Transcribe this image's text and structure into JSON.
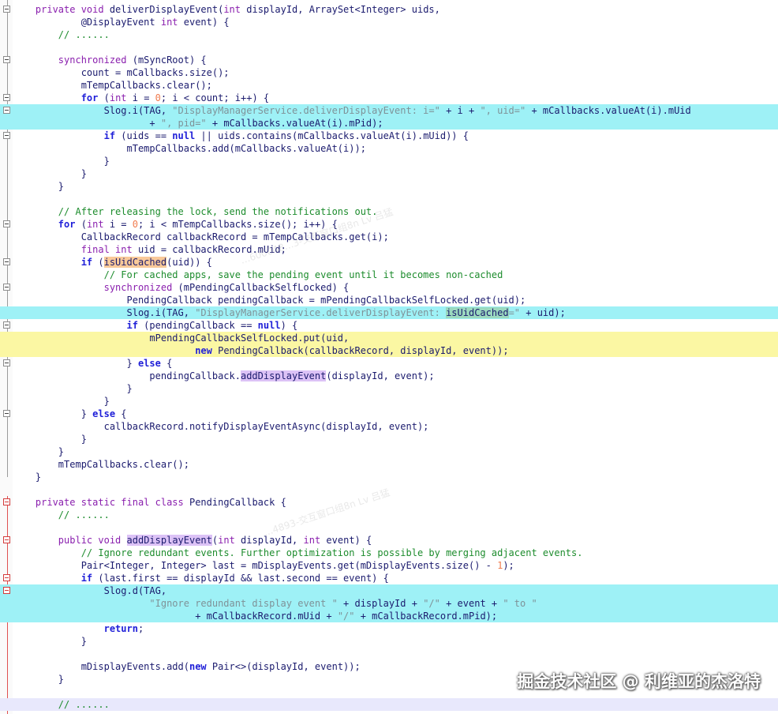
{
  "watermark": "掘金技术社区 @ 利维亚的杰洛特",
  "faint_watermarks": [
    "…600048…3-交互窗口组8n Lv 吕猛",
    "…4893-交互窗口组8n Lv 吕猛"
  ],
  "colors": {
    "highlight_cyan": "#9ef1f6",
    "highlight_yellow": "#fbf7a3",
    "highlight_lavender": "#e8e8fc",
    "keyword": "#8a1fae",
    "literal_keyword": "#1f1fd8",
    "string": "#7f9298",
    "number": "#f07c4f",
    "comment": "#1d8c2d",
    "identifier": "#1b1b6e"
  },
  "code_lines": [
    {
      "fold": "minus",
      "hl": "",
      "tokens": [
        [
          "    ",
          ""
        ],
        [
          "private void",
          "kw"
        ],
        [
          " deliverDisplayEvent(",
          ""
        ],
        [
          "int",
          "kw"
        ],
        [
          " displayId, ArraySet<Integer> uids,",
          ""
        ]
      ]
    },
    {
      "fold": "",
      "hl": "",
      "tokens": [
        [
          "            @DisplayEvent ",
          ""
        ],
        [
          "int",
          "kw"
        ],
        [
          " event) {",
          ""
        ]
      ]
    },
    {
      "fold": "",
      "hl": "",
      "tokens": [
        [
          "        ",
          ""
        ],
        [
          "// ......",
          "cmt"
        ]
      ]
    },
    {
      "fold": "",
      "hl": "",
      "tokens": [
        [
          "",
          ""
        ]
      ]
    },
    {
      "fold": "minus",
      "hl": "",
      "tokens": [
        [
          "        ",
          ""
        ],
        [
          "synchronized",
          "kw"
        ],
        [
          " (mSyncRoot) {",
          ""
        ]
      ]
    },
    {
      "fold": "",
      "hl": "",
      "tokens": [
        [
          "            count = mCallbacks.size();",
          ""
        ]
      ]
    },
    {
      "fold": "",
      "hl": "",
      "tokens": [
        [
          "            mTempCallbacks.clear();",
          ""
        ]
      ]
    },
    {
      "fold": "minus",
      "hl": "",
      "tokens": [
        [
          "            ",
          ""
        ],
        [
          "for",
          "kw2"
        ],
        [
          " (",
          ""
        ],
        [
          "int",
          "kw"
        ],
        [
          " i = ",
          ""
        ],
        [
          "0",
          "num"
        ],
        [
          "; i < count; i++) {",
          ""
        ]
      ]
    },
    {
      "fold": "minus",
      "hl": "cyan",
      "tokens": [
        [
          "                Slog.i(TAG, ",
          ""
        ],
        [
          "\"DisplayManagerService.deliverDisplayEvent: i=\"",
          "str"
        ],
        [
          " + i + ",
          ""
        ],
        [
          "\", uid=\"",
          "str"
        ],
        [
          " + mCallbacks.valueAt(i).mUid",
          ""
        ]
      ]
    },
    {
      "fold": "",
      "hl": "cyan",
      "tokens": [
        [
          "                        + ",
          ""
        ],
        [
          "\", pid=\"",
          "str"
        ],
        [
          " + mCallbacks.valueAt(i).mPid);",
          ""
        ]
      ]
    },
    {
      "fold": "minus",
      "hl": "",
      "tokens": [
        [
          "                ",
          ""
        ],
        [
          "if",
          "kw2"
        ],
        [
          " (uids == ",
          ""
        ],
        [
          "null",
          "kw2"
        ],
        [
          " || uids.contains(mCallbacks.valueAt(i).mUid)) {",
          ""
        ]
      ]
    },
    {
      "fold": "",
      "hl": "",
      "tokens": [
        [
          "                    mTempCallbacks.add(mCallbacks.valueAt(i));",
          ""
        ]
      ]
    },
    {
      "fold": "",
      "hl": "",
      "tokens": [
        [
          "                }",
          ""
        ]
      ]
    },
    {
      "fold": "",
      "hl": "",
      "tokens": [
        [
          "            }",
          ""
        ]
      ]
    },
    {
      "fold": "",
      "hl": "",
      "tokens": [
        [
          "        }",
          ""
        ]
      ]
    },
    {
      "fold": "",
      "hl": "",
      "tokens": [
        [
          "",
          ""
        ]
      ]
    },
    {
      "fold": "",
      "hl": "",
      "tokens": [
        [
          "        ",
          ""
        ],
        [
          "// After releasing the lock, send the notifications out.",
          "cmt"
        ]
      ]
    },
    {
      "fold": "minus",
      "hl": "",
      "tokens": [
        [
          "        ",
          ""
        ],
        [
          "for",
          "kw2"
        ],
        [
          " (",
          ""
        ],
        [
          "int",
          "kw"
        ],
        [
          " i = ",
          ""
        ],
        [
          "0",
          "num"
        ],
        [
          "; i < mTempCallbacks.size(); i++) {",
          ""
        ]
      ]
    },
    {
      "fold": "",
      "hl": "",
      "tokens": [
        [
          "            CallbackRecord callbackRecord = mTempCallbacks.get(i);",
          ""
        ]
      ]
    },
    {
      "fold": "",
      "hl": "",
      "tokens": [
        [
          "            ",
          ""
        ],
        [
          "final int",
          "kw"
        ],
        [
          " uid = callbackRecord.mUid;",
          ""
        ]
      ]
    },
    {
      "fold": "minus",
      "hl": "",
      "tokens": [
        [
          "            ",
          ""
        ],
        [
          "if",
          "kw2"
        ],
        [
          " (",
          ""
        ],
        [
          "isUidCached",
          "occ-orange"
        ],
        [
          "(uid)) {",
          ""
        ]
      ]
    },
    {
      "fold": "",
      "hl": "",
      "tokens": [
        [
          "                ",
          ""
        ],
        [
          "// For cached apps, save the pending event until it becomes non-cached",
          "cmt"
        ]
      ]
    },
    {
      "fold": "minus",
      "hl": "",
      "tokens": [
        [
          "                ",
          ""
        ],
        [
          "synchronized",
          "kw"
        ],
        [
          " (mPendingCallbackSelfLocked) {",
          ""
        ]
      ]
    },
    {
      "fold": "",
      "hl": "",
      "tokens": [
        [
          "                    PendingCallback pendingCallback = mPendingCallbackSelfLocked.get(uid);",
          ""
        ]
      ]
    },
    {
      "fold": "",
      "hl": "cyan",
      "tokens": [
        [
          "                    Slog.i(TAG, ",
          ""
        ],
        [
          "\"DisplayManagerService.deliverDisplayEvent: ",
          "str"
        ],
        [
          "isUidCached",
          "occ-green"
        ],
        [
          "=\"",
          "str"
        ],
        [
          " + uid);",
          ""
        ]
      ]
    },
    {
      "fold": "minus",
      "hl": "",
      "tokens": [
        [
          "                    ",
          ""
        ],
        [
          "if",
          "kw2"
        ],
        [
          " (pendingCallback == ",
          ""
        ],
        [
          "null",
          "kw2"
        ],
        [
          ") {",
          ""
        ]
      ]
    },
    {
      "fold": "",
      "hl": "yellow",
      "tokens": [
        [
          "                        mPendingCallbackSelfLocked.put(uid,",
          ""
        ]
      ]
    },
    {
      "fold": "",
      "hl": "yellow",
      "tokens": [
        [
          "                                ",
          ""
        ],
        [
          "new",
          "kw2"
        ],
        [
          " PendingCallback(callbackRecord, displayId, event));",
          ""
        ]
      ]
    },
    {
      "fold": "minus",
      "hl": "",
      "tokens": [
        [
          "                    } ",
          ""
        ],
        [
          "else",
          "kw2"
        ],
        [
          " {",
          ""
        ]
      ]
    },
    {
      "fold": "",
      "hl": "",
      "tokens": [
        [
          "                        pendingCallback.",
          ""
        ],
        [
          "addDisplayEvent",
          "occ-purple"
        ],
        [
          "(displayId, event);",
          ""
        ]
      ]
    },
    {
      "fold": "",
      "hl": "",
      "tokens": [
        [
          "                    }",
          ""
        ]
      ]
    },
    {
      "fold": "",
      "hl": "",
      "tokens": [
        [
          "                }",
          ""
        ]
      ]
    },
    {
      "fold": "minus",
      "hl": "",
      "tokens": [
        [
          "            } ",
          ""
        ],
        [
          "else",
          "kw2"
        ],
        [
          " {",
          ""
        ]
      ]
    },
    {
      "fold": "",
      "hl": "",
      "tokens": [
        [
          "                callbackRecord.notifyDisplayEventAsync(displayId, event);",
          ""
        ]
      ]
    },
    {
      "fold": "",
      "hl": "",
      "tokens": [
        [
          "            }",
          ""
        ]
      ]
    },
    {
      "fold": "",
      "hl": "",
      "tokens": [
        [
          "        }",
          ""
        ]
      ]
    },
    {
      "fold": "",
      "hl": "",
      "tokens": [
        [
          "        mTempCallbacks.clear();",
          ""
        ]
      ]
    },
    {
      "fold": "",
      "hl": "",
      "tokens": [
        [
          "    }",
          ""
        ]
      ]
    },
    {
      "fold": "",
      "hl": "",
      "tokens": [
        [
          "",
          ""
        ]
      ]
    },
    {
      "fold": "minus-red",
      "hl": "",
      "tokens": [
        [
          "    ",
          ""
        ],
        [
          "private static final class",
          "kw"
        ],
        [
          " PendingCallback {",
          ""
        ]
      ]
    },
    {
      "fold": "",
      "hl": "",
      "tokens": [
        [
          "        ",
          ""
        ],
        [
          "// ......",
          "cmt"
        ]
      ]
    },
    {
      "fold": "",
      "hl": "",
      "tokens": [
        [
          "",
          ""
        ]
      ]
    },
    {
      "fold": "minus-red",
      "hl": "",
      "tokens": [
        [
          "        ",
          ""
        ],
        [
          "public void",
          "kw"
        ],
        [
          " ",
          ""
        ],
        [
          "addDisplayEvent",
          "occ-purple"
        ],
        [
          "(",
          ""
        ],
        [
          "int",
          "kw"
        ],
        [
          " displayId, ",
          ""
        ],
        [
          "int",
          "kw"
        ],
        [
          " event) {",
          ""
        ]
      ]
    },
    {
      "fold": "",
      "hl": "",
      "tokens": [
        [
          "            ",
          ""
        ],
        [
          "// Ignore redundant events. Further optimization is possible by merging adjacent events.",
          "cmt"
        ]
      ]
    },
    {
      "fold": "",
      "hl": "",
      "tokens": [
        [
          "            Pair<Integer, Integer> last = mDisplayEvents.get(mDisplayEvents.size() - ",
          ""
        ],
        [
          "1",
          "num"
        ],
        [
          ");",
          ""
        ]
      ]
    },
    {
      "fold": "minus-red",
      "hl": "",
      "tokens": [
        [
          "            ",
          ""
        ],
        [
          "if",
          "kw2"
        ],
        [
          " (last.first == displayId && last.second == event) {",
          ""
        ]
      ]
    },
    {
      "fold": "minus-red",
      "hl": "cyan",
      "tokens": [
        [
          "                Slog.d(TAG,",
          ""
        ]
      ]
    },
    {
      "fold": "",
      "hl": "cyan",
      "tokens": [
        [
          "                        ",
          ""
        ],
        [
          "\"Ignore redundant display event \"",
          "str"
        ],
        [
          " + displayId + ",
          ""
        ],
        [
          "\"/\"",
          "str"
        ],
        [
          " + event + ",
          ""
        ],
        [
          "\" to \"",
          "str"
        ]
      ]
    },
    {
      "fold": "",
      "hl": "cyan",
      "tokens": [
        [
          "                                + mCallbackRecord.mUid + ",
          ""
        ],
        [
          "\"/\"",
          "str"
        ],
        [
          " + mCallbackRecord.mPid);",
          ""
        ]
      ]
    },
    {
      "fold": "",
      "hl": "",
      "tokens": [
        [
          "                ",
          ""
        ],
        [
          "return",
          "kw2"
        ],
        [
          ";",
          ""
        ]
      ]
    },
    {
      "fold": "",
      "hl": "",
      "tokens": [
        [
          "            }",
          ""
        ]
      ]
    },
    {
      "fold": "",
      "hl": "",
      "tokens": [
        [
          "",
          ""
        ]
      ]
    },
    {
      "fold": "",
      "hl": "",
      "tokens": [
        [
          "            mDisplayEvents.add(",
          ""
        ],
        [
          "new",
          "kw2"
        ],
        [
          " Pair<>(displayId, event));",
          ""
        ]
      ]
    },
    {
      "fold": "",
      "hl": "",
      "tokens": [
        [
          "        }",
          ""
        ]
      ]
    },
    {
      "fold": "",
      "hl": "",
      "tokens": [
        [
          "",
          ""
        ]
      ]
    },
    {
      "fold": "",
      "hl": "lav",
      "tokens": [
        [
          "        ",
          ""
        ],
        [
          "// ......",
          "cmt"
        ]
      ]
    }
  ]
}
